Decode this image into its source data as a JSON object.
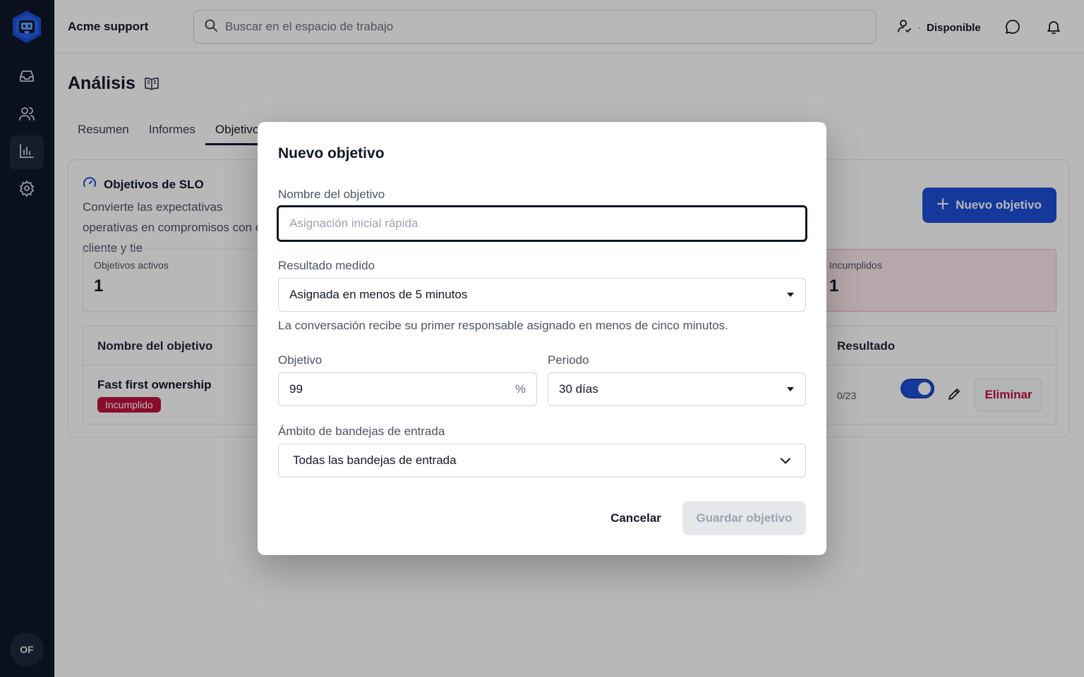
{
  "app": {
    "workspace_name": "Acme support",
    "avatar_initials": "OF"
  },
  "sidebar": {
    "items": [
      {
        "icon": "inbox-icon",
        "label": "Bandejas de entrada"
      },
      {
        "icon": "users-icon",
        "label": "Contactos"
      },
      {
        "icon": "chart-icon",
        "label": "Análisis",
        "active": true
      },
      {
        "icon": "gear-icon",
        "label": "Configuración"
      }
    ]
  },
  "topbar": {
    "search_placeholder": "Buscar en el espacio de trabajo",
    "status_label": "Disponible"
  },
  "page": {
    "title": "Análisis",
    "tabs": [
      {
        "label": "Resumen"
      },
      {
        "label": "Informes"
      },
      {
        "label": "Objetivos",
        "active": true
      }
    ]
  },
  "slo_card": {
    "title": "Objetivos de SLO",
    "description": "Convierte las expectativas operativas en compromisos con el cliente y tie",
    "new_goal_label": "Nuevo objetivo",
    "metrics": {
      "active": {
        "label": "Objetivos activos",
        "value": "1"
      },
      "breached": {
        "label": "Incumplidos",
        "value": "1"
      }
    },
    "table": {
      "col_name": "Nombre del objetivo",
      "col_result": "Resultado",
      "rows": [
        {
          "name": "Fast first ownership",
          "status": "Incumplido",
          "count": "0/23",
          "enabled": true,
          "delete_label": "Eliminar"
        }
      ]
    }
  },
  "modal": {
    "title": "Nuevo objetivo",
    "name_label": "Nombre del objetivo",
    "name_placeholder": "Asignación inicial rápida",
    "outcome_label": "Resultado medido",
    "outcome_value": "Asignada en menos de 5 minutos",
    "outcome_help": "La conversación recibe su primer responsable asignado en menos de cinco minutos.",
    "target_label": "Objetivo",
    "target_value": "99",
    "target_unit": "%",
    "period_label": "Periodo",
    "period_value": "30 días",
    "scope_label": "Ámbito de bandejas de entrada",
    "scope_value": "Todas las bandejas de entrada",
    "cancel_label": "Cancelar",
    "save_label": "Guardar objetivo"
  },
  "colors": {
    "sidebar_bg": "#0f172a",
    "primary": "#1d4ed8",
    "danger": "#be123c"
  }
}
